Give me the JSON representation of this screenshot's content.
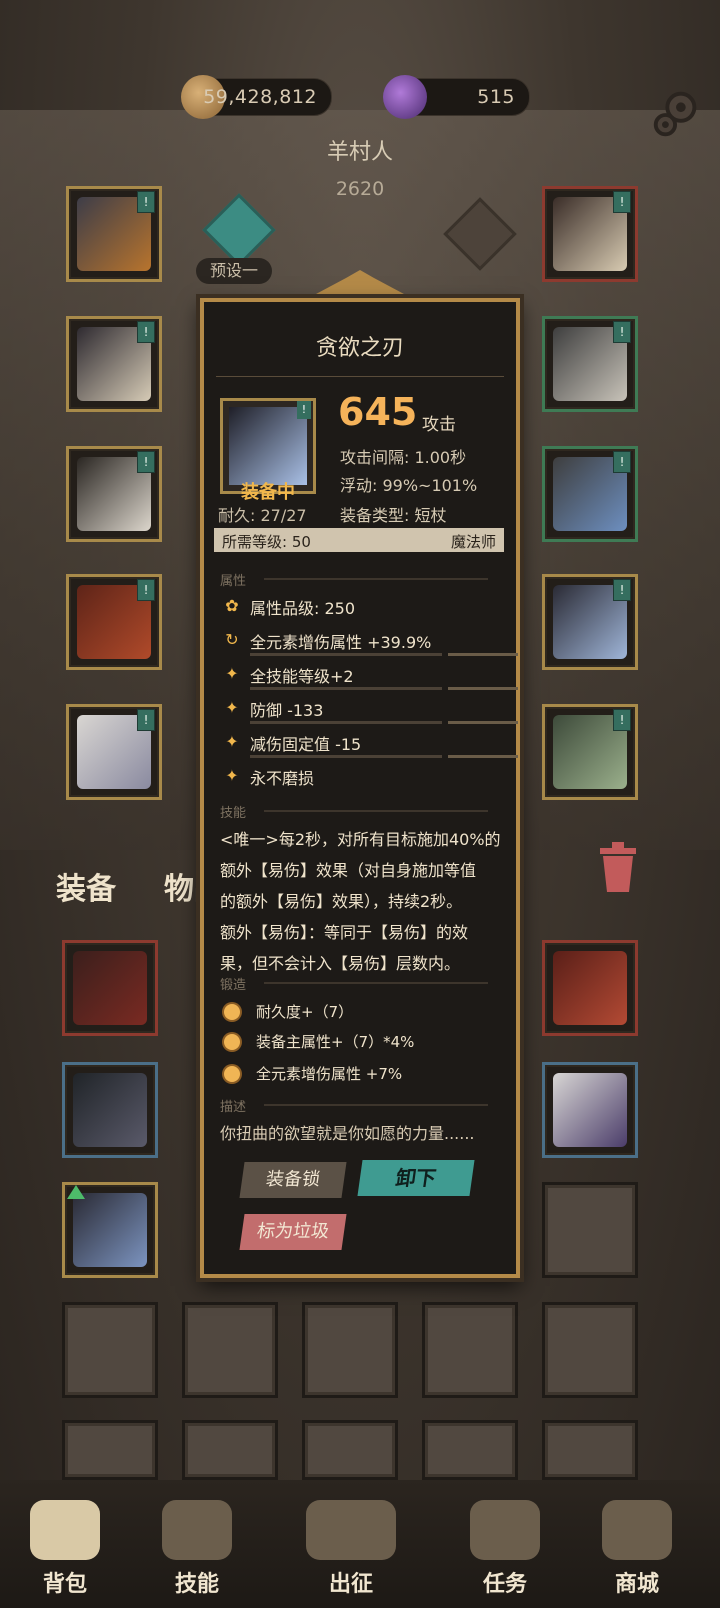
{
  "resources": {
    "gold": "59,428,812",
    "gems": "515"
  },
  "character": {
    "name": "羊村人",
    "power": "2620",
    "preset_label": "预设一"
  },
  "tabs": {
    "equipment": "装备",
    "items": "物品"
  },
  "item_popup": {
    "name": "贪欲之刃",
    "equipped_label": "装备中",
    "durability": "耐久: 27/27",
    "attack_value": "645",
    "attack_unit": "攻击",
    "attack_interval": "攻击间隔: 1.00秒",
    "variance": "浮动: 99%~101%",
    "equip_type": "装备类型: 短杖",
    "required_level": "所需等级: 50",
    "class": "魔法师",
    "sections": {
      "attributes": "属性",
      "skill": "技能",
      "forge": "锻造",
      "description": "描述"
    },
    "attributes": [
      "属性品级: 250",
      "全元素增伤属性 +39.9%",
      "全技能等级+2",
      "防御 -133",
      "减伤固定值 -15",
      "永不磨损"
    ],
    "skill_lines": [
      "<唯一>每2秒，对所有目标施加40%的",
      "额外【易伤】效果（对自身施加等值",
      "的额外【易伤】效果），持续2秒。",
      "额外【易伤】：等同于【易伤】的效",
      "果，但不会计入【易伤】层数内。"
    ],
    "forge": [
      "耐久度+（7）",
      "装备主属性+（7）*4%",
      "全元素增伤属性 +7%"
    ],
    "description": "你扭曲的欲望就是你如愿的力量......",
    "buttons": {
      "lock": "装备锁",
      "unequip": "卸下",
      "mark_trash": "标为垃圾"
    }
  },
  "nav": {
    "bag": "背包",
    "skills": "技能",
    "expedition": "出征",
    "quests": "任务",
    "shop": "商城"
  },
  "colors": {
    "gold_accent": "#f5b35a",
    "frame_gold": "#b48a48",
    "teal_button": "#3f9b91",
    "trash_button": "#c26d6d"
  }
}
